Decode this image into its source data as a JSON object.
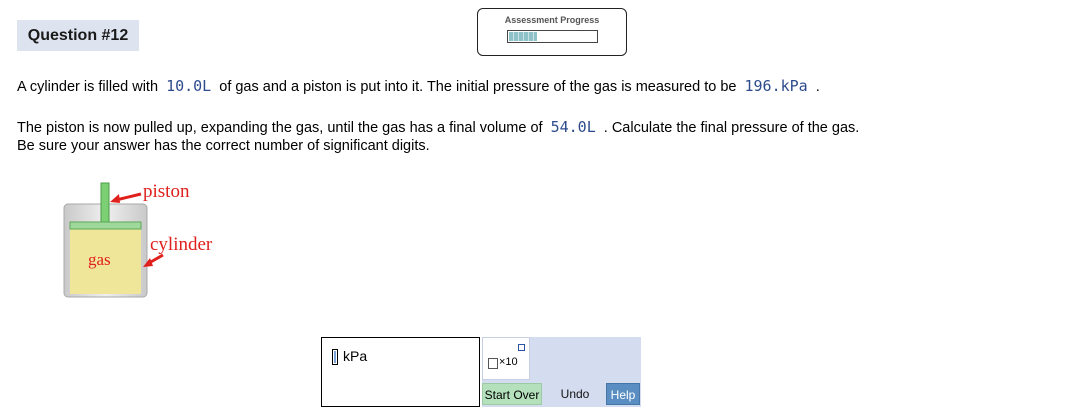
{
  "question": {
    "label": "Question #12"
  },
  "progress": {
    "title": "Assessment Progress",
    "fraction": 0.32
  },
  "problem": {
    "line1_a": "A cylinder is filled with",
    "line1_v1": "10.0L",
    "line1_b": "of gas and a piston is put into it. The initial pressure of the gas is measured to be",
    "line1_v2": "196.kPa",
    "line1_c": ".",
    "line2_a": "The piston is now pulled up, expanding the gas, until the gas has a final volume of",
    "line2_v": "54.0L",
    "line2_b": ". Calculate the final pressure of the gas.",
    "line3": "Be sure your answer has the correct number of significant digits."
  },
  "diagram": {
    "piston_label": "piston",
    "cylinder_label": "cylinder",
    "gas_label": "gas",
    "label_color": "#e0201c"
  },
  "answer": {
    "unit": "kPa",
    "sci_notation": "×10"
  },
  "buttons": {
    "start_over": "Start Over",
    "undo": "Undo",
    "help": "Help"
  }
}
